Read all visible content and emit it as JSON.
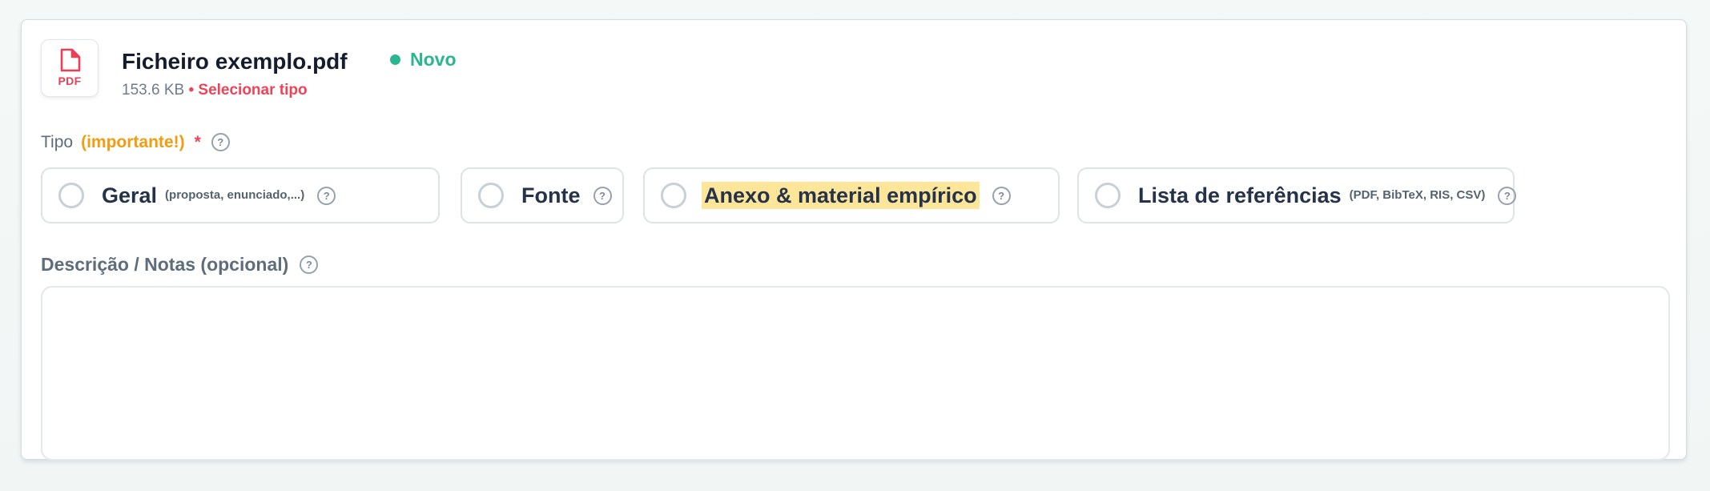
{
  "file": {
    "type_label": "PDF",
    "name": "Ficheiro exemplo.pdf",
    "status": "Novo",
    "size": "153.6 KB",
    "separator": " • ",
    "select_type_label": "Selecionar tipo"
  },
  "tipo": {
    "label": "Tipo",
    "important": "(importante!)",
    "required_mark": "*",
    "options": [
      {
        "label": "Geral",
        "hint": "(proposta, enunciado,...)"
      },
      {
        "label": "Fonte",
        "hint": ""
      },
      {
        "label": "Anexo & material empírico",
        "hint": ""
      },
      {
        "label": "Lista de referências",
        "hint": "(PDF, BibTeX, RIS, CSV)"
      }
    ]
  },
  "description": {
    "label": "Descrição / Notas (opcional)",
    "value": "",
    "placeholder": ""
  },
  "help_glyph": "?",
  "colors": {
    "accent_green": "#2ab78f",
    "accent_red": "#ef4458",
    "important_orange": "#f29d0f",
    "highlight_yellow": "#fde59a",
    "title_dark": "#141c2e"
  }
}
